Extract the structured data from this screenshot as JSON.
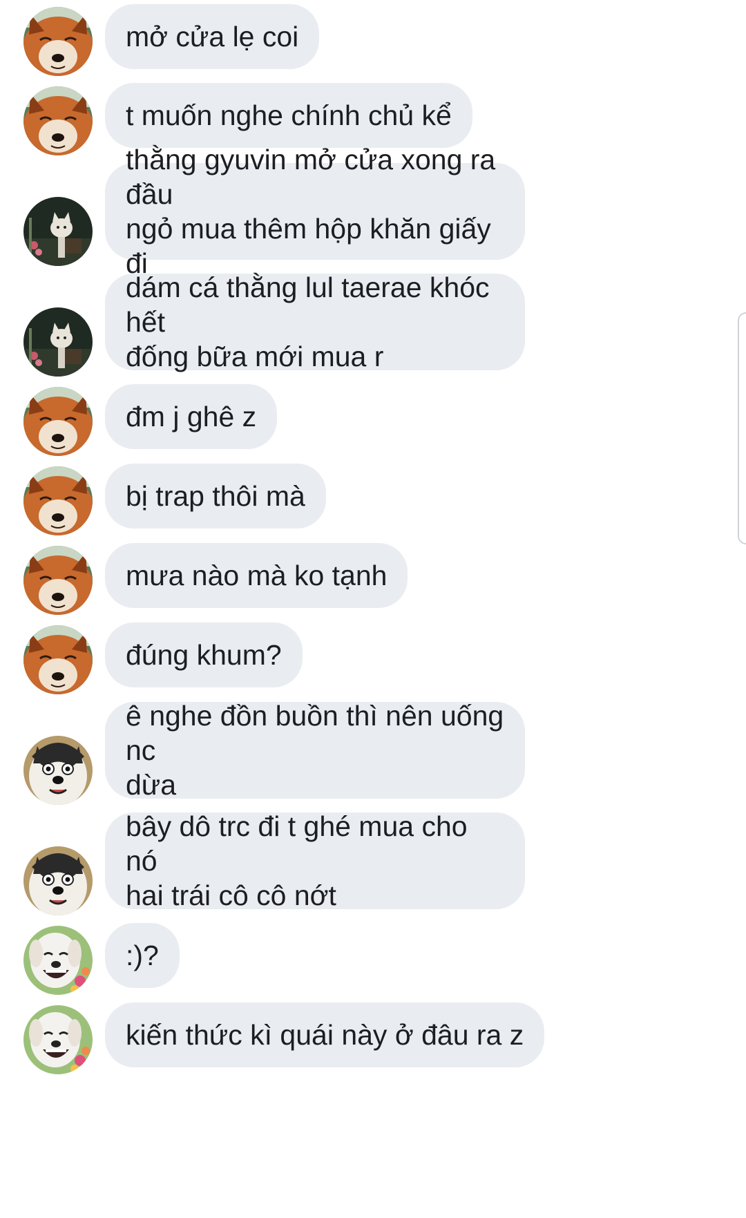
{
  "conversation": {
    "messages": [
      {
        "avatar": "fox-avatar",
        "text": "mở cửa lẹ coi"
      },
      {
        "avatar": "fox-avatar",
        "text": "t muốn nghe chính chủ kể"
      },
      {
        "avatar": "cat-avatar",
        "text": "thằng gyuvin mở cửa xong ra đầu\nngỏ mua thêm hộp khăn giấy đi"
      },
      {
        "avatar": "cat-avatar",
        "text": "dám cá thằng lul taerae khóc hết\nđống bữa mới mua r"
      },
      {
        "avatar": "fox-avatar",
        "text": "đm j ghê z"
      },
      {
        "avatar": "fox-avatar",
        "text": "bị trap thôi mà"
      },
      {
        "avatar": "fox-avatar",
        "text": "mưa nào mà ko tạnh"
      },
      {
        "avatar": "fox-avatar",
        "text": "đúng khum?"
      },
      {
        "avatar": "husky-avatar",
        "text": "ê nghe đồn buồn thì nên uống nc\ndừa"
      },
      {
        "avatar": "husky-avatar",
        "text": "bây dô trc đi t ghé mua cho nó\nhai trái cô cô nớt"
      },
      {
        "avatar": "white-dog-avatar",
        "text": ":)?"
      },
      {
        "avatar": "white-dog-avatar",
        "text": "kiến thức kì quái này ở đâu ra z"
      }
    ]
  },
  "colors": {
    "bubble_background": "#e9ecf0",
    "text": "#1c1e21",
    "page_background": "#ffffff"
  }
}
